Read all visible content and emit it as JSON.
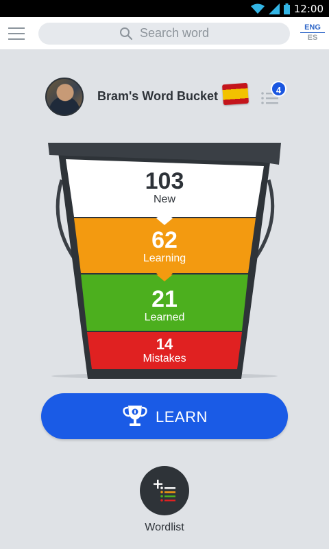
{
  "status_bar": {
    "time": "12:00"
  },
  "search": {
    "placeholder": "Search word"
  },
  "language": {
    "from": "ENG",
    "to": "ES"
  },
  "profile": {
    "bucket_name": "Bram's Word Bucket",
    "flag": "spain-flag",
    "list_badge": "4"
  },
  "bucket": {
    "new": {
      "count": "103",
      "label": "New",
      "color": "#ffffff"
    },
    "learning": {
      "count": "62",
      "label": "Learning",
      "color": "#f39a10"
    },
    "learned": {
      "count": "21",
      "label": "Learned",
      "color": "#4caf1e"
    },
    "mistakes": {
      "count": "14",
      "label": "Mistakes",
      "color": "#e02121"
    }
  },
  "actions": {
    "learn": "LEARN",
    "wordlist": "Wordlist"
  },
  "colors": {
    "accent": "#1a5be6",
    "background": "#dfe2e6",
    "bucket_dark": "#2e3338"
  }
}
